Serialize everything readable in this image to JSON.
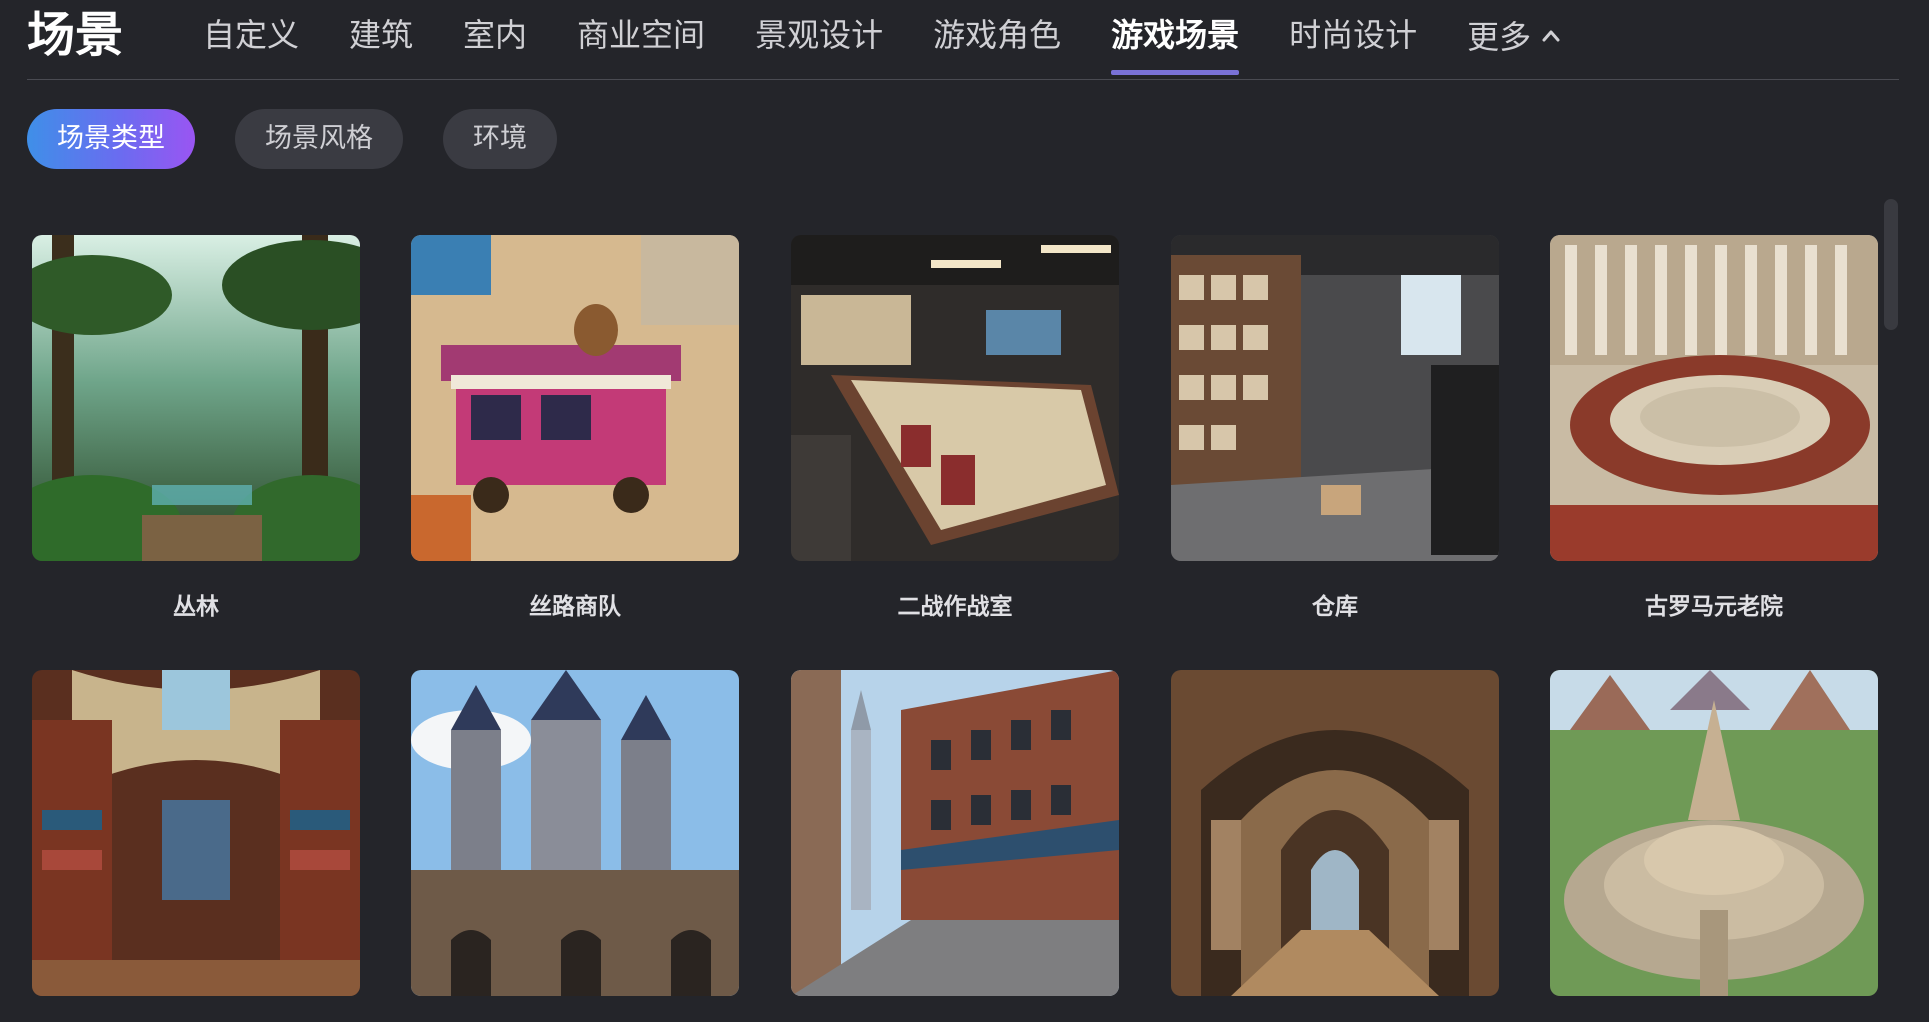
{
  "header": {
    "brand": "场景",
    "nav": [
      {
        "label": "自定义",
        "active": false
      },
      {
        "label": "建筑",
        "active": false
      },
      {
        "label": "室内",
        "active": false
      },
      {
        "label": "商业空间",
        "active": false
      },
      {
        "label": "景观设计",
        "active": false
      },
      {
        "label": "游戏角色",
        "active": false
      },
      {
        "label": "游戏场景",
        "active": true
      },
      {
        "label": "时尚设计",
        "active": false
      },
      {
        "label": "更多",
        "active": false,
        "icon": "chevron-up-icon"
      }
    ]
  },
  "filters": [
    {
      "label": "场景类型",
      "active": true
    },
    {
      "label": "场景风格",
      "active": false
    },
    {
      "label": "环境",
      "active": false
    }
  ],
  "cards": [
    {
      "label": "丛林",
      "image": "jungle-image"
    },
    {
      "label": "丝路商队",
      "image": "silk-road-caravan-image"
    },
    {
      "label": "二战作战室",
      "image": "ww2-war-room-image"
    },
    {
      "label": "仓库",
      "image": "warehouse-image"
    },
    {
      "label": "古罗马元老院",
      "image": "roman-senate-image"
    },
    {
      "label": "",
      "image": "library-image"
    },
    {
      "label": "",
      "image": "castle-image"
    },
    {
      "label": "",
      "image": "city-street-image"
    },
    {
      "label": "",
      "image": "tunnel-image"
    },
    {
      "label": "",
      "image": "temple-image"
    }
  ],
  "colors": {
    "background": "#24252a",
    "accent": "#7a72d8",
    "pill_gradient_start": "#3f8fe8",
    "pill_gradient_end": "#9a55f2"
  }
}
